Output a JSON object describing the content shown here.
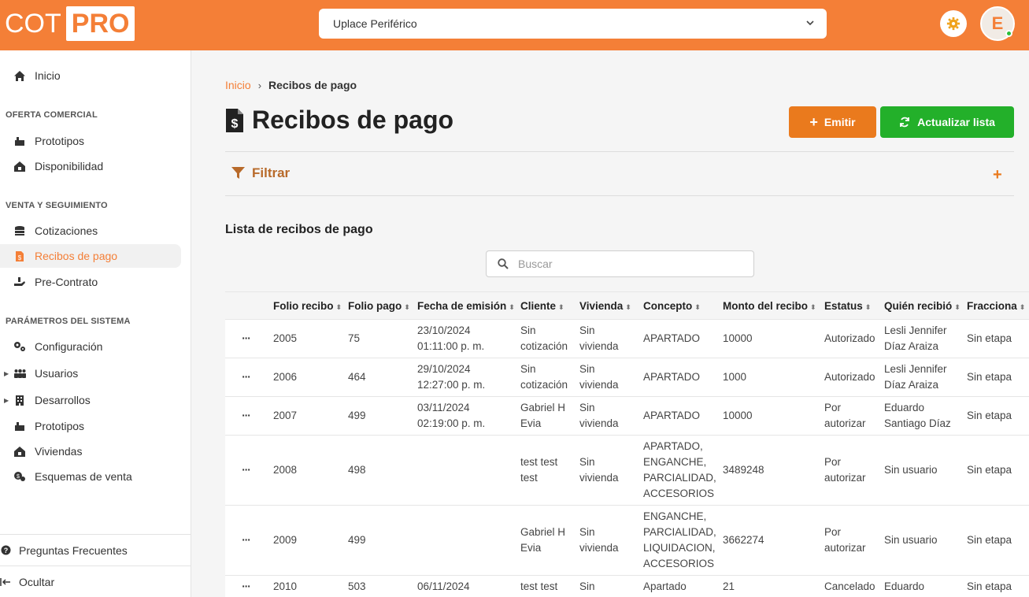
{
  "header": {
    "logo_left": "COT",
    "logo_right": "PRO",
    "place_selected": "Uplace Periférico",
    "avatar_initial": "E",
    "accent_color": "#f47f37"
  },
  "sidebar": {
    "home": "Inicio",
    "section_oferta": "OFERTA COMERCIAL",
    "prototipos_1": "Prototipos",
    "disponibilidad": "Disponibilidad",
    "section_venta": "VENTA Y SEGUIMIENTO",
    "cotizaciones": "Cotizaciones",
    "recibos": "Recibos de pago",
    "precontrato": "Pre-Contrato",
    "section_parametros": "PARÁMETROS DEL SISTEMA",
    "configuracion": "Configuración",
    "usuarios": "Usuarios",
    "desarrollos": "Desarrollos",
    "prototipos_2": "Prototipos",
    "viviendas": "Viviendas",
    "esquemas": "Esquemas de venta",
    "faq": "Preguntas Frecuentes",
    "hide": "Ocultar"
  },
  "main": {
    "breadcrumb_home": "Inicio",
    "breadcrumb_current": "Recibos de pago",
    "title": "Recibos de pago",
    "emit_label": "Emitir",
    "refresh_label": "Actualizar lista",
    "filter_label": "Filtrar",
    "list_title": "Lista de recibos de pago",
    "search_placeholder": "Buscar"
  },
  "table": {
    "headers": [
      "Folio recibo",
      "Folio pago",
      "Fecha de emisión",
      "Cliente",
      "Vivienda",
      "Concepto",
      "Monto del recibo",
      "Estatus",
      "Quién recibió",
      "Fracciona"
    ],
    "rows": [
      {
        "menu": "···",
        "folio_recibo": "2005",
        "folio_pago": "75",
        "fecha": [
          "23/10/2024",
          "01:11:00 p. m."
        ],
        "cliente": [
          "Sin",
          "cotización"
        ],
        "vivienda": [
          "Sin",
          "vivienda"
        ],
        "concepto": [
          "APARTADO"
        ],
        "monto": "10000",
        "estatus": [
          "Autorizado"
        ],
        "quien": [
          "Lesli Jennifer",
          "Díaz Araiza"
        ],
        "fracciona": "Sin etapa"
      },
      {
        "menu": "···",
        "folio_recibo": "2006",
        "folio_pago": "464",
        "fecha": [
          "29/10/2024",
          "12:27:00 p. m."
        ],
        "cliente": [
          "Sin",
          "cotización"
        ],
        "vivienda": [
          "Sin",
          "vivienda"
        ],
        "concepto": [
          "APARTADO"
        ],
        "monto": "1000",
        "estatus": [
          "Autorizado"
        ],
        "quien": [
          "Lesli Jennifer",
          "Díaz Araiza"
        ],
        "fracciona": "Sin etapa"
      },
      {
        "menu": "···",
        "folio_recibo": "2007",
        "folio_pago": "499",
        "fecha": [
          "03/11/2024",
          "02:19:00 p. m."
        ],
        "cliente": [
          "Gabriel H",
          "Evia"
        ],
        "vivienda": [
          "Sin",
          "vivienda"
        ],
        "concepto": [
          "APARTADO"
        ],
        "monto": "10000",
        "estatus": [
          "Por",
          "autorizar"
        ],
        "quien": [
          "Eduardo",
          "Santiago Díaz"
        ],
        "fracciona": "Sin etapa"
      },
      {
        "menu": "···",
        "folio_recibo": "2008",
        "folio_pago": "498",
        "fecha": [],
        "cliente": [
          "test test",
          "test"
        ],
        "vivienda": [
          "Sin",
          "vivienda"
        ],
        "concepto": [
          "APARTADO,",
          "ENGANCHE,",
          "PARCIALIDAD,",
          "ACCESORIOS"
        ],
        "monto": "3489248",
        "estatus": [
          "Por",
          "autorizar"
        ],
        "quien": [
          "Sin usuario"
        ],
        "fracciona": "Sin etapa"
      },
      {
        "menu": "···",
        "folio_recibo": "2009",
        "folio_pago": "499",
        "fecha": [],
        "cliente": [
          "Gabriel H",
          "Evia"
        ],
        "vivienda": [
          "Sin",
          "vivienda"
        ],
        "concepto": [
          "ENGANCHE,",
          "PARCIALIDAD,",
          "LIQUIDACION,",
          "ACCESORIOS"
        ],
        "monto": "3662274",
        "estatus": [
          "Por",
          "autorizar"
        ],
        "quien": [
          "Sin usuario"
        ],
        "fracciona": "Sin etapa"
      },
      {
        "menu": "···",
        "folio_recibo": "2010",
        "folio_pago": "503",
        "fecha": [
          "06/11/2024"
        ],
        "cliente": [
          "test test"
        ],
        "vivienda": [
          "Sin"
        ],
        "concepto": [
          "Apartado"
        ],
        "monto": "21",
        "estatus": [
          "Cancelado"
        ],
        "quien": [
          "Eduardo"
        ],
        "fracciona": "Sin etapa"
      }
    ]
  },
  "icons": {
    "home": "home-icon",
    "gear": "gear-icon",
    "chevron": "chevron-down-icon",
    "receipt": "receipt-icon",
    "filter": "filter-icon",
    "search": "search-icon",
    "refresh": "refresh-icon",
    "plus": "plus-icon"
  }
}
